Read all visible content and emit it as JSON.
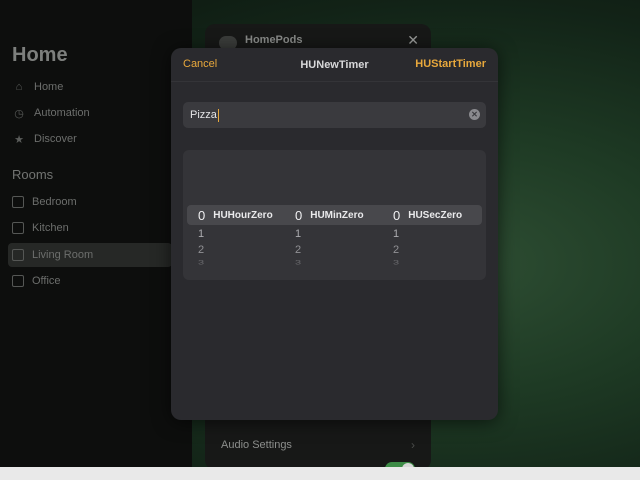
{
  "sidebar": {
    "title": "Home",
    "nav": [
      {
        "label": "Home",
        "icon": "house-icon"
      },
      {
        "label": "Automation",
        "icon": "clock-check-icon"
      },
      {
        "label": "Discover",
        "icon": "star-icon"
      }
    ],
    "rooms_heading": "Rooms",
    "rooms": [
      {
        "label": "Bedroom"
      },
      {
        "label": "Kitchen"
      },
      {
        "label": "Living Room",
        "selected": true
      },
      {
        "label": "Office"
      }
    ]
  },
  "background_panel": {
    "title": "HomePods",
    "close_glyph": "✕",
    "audio_settings_label": "Audio Settings"
  },
  "modal": {
    "cancel_label": "Cancel",
    "title": "HUNewTimer",
    "start_label": "HUStartTimer",
    "name_field_value": "Pizza",
    "accent_color": "#e8a83c",
    "picker": {
      "hours": {
        "selected": "0",
        "unit": "HUHourZero",
        "options": [
          "1",
          "2",
          "3"
        ]
      },
      "minutes": {
        "selected": "0",
        "unit": "HUMinZero",
        "options": [
          "1",
          "2",
          "3"
        ]
      },
      "seconds": {
        "selected": "0",
        "unit": "HUSecZero",
        "options": [
          "1",
          "2",
          "3"
        ]
      }
    }
  }
}
